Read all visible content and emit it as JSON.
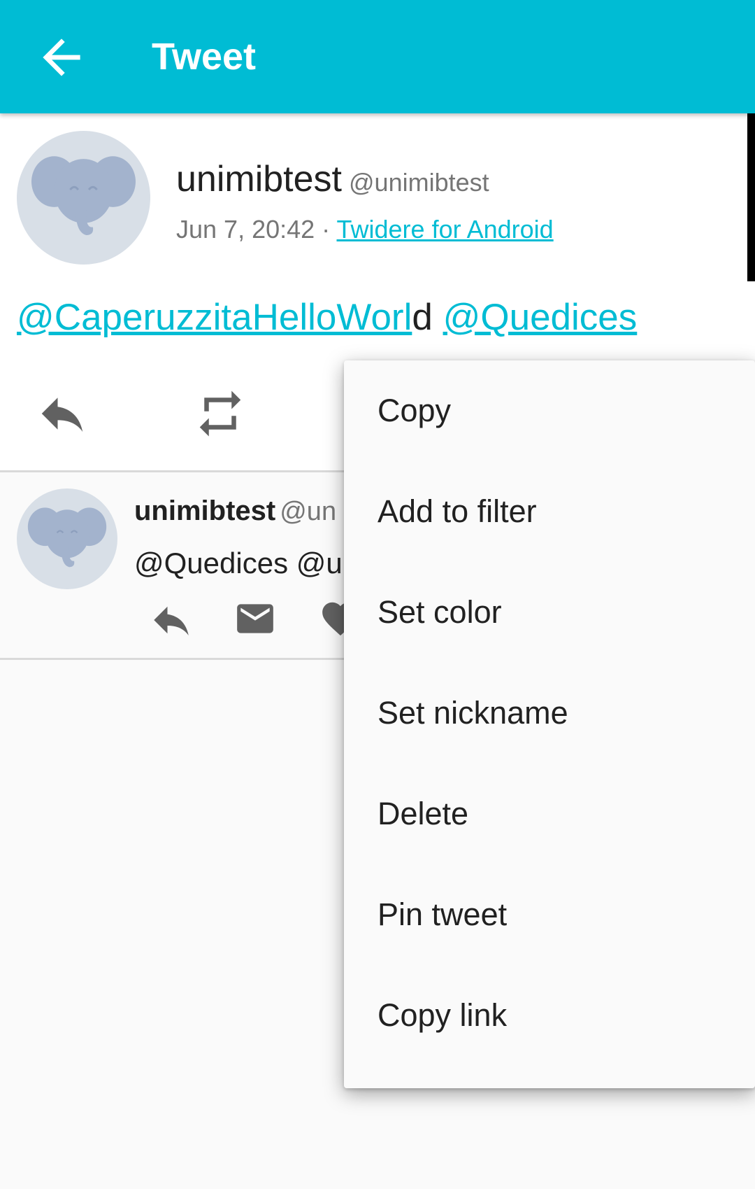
{
  "appbar": {
    "title": "Tweet",
    "back_icon": "arrow-back-icon"
  },
  "status": {
    "user_name": "unimibtest",
    "user_handle": "@unimibtest",
    "time": "Jun 7, 20:42",
    "separator": " · ",
    "source": "Twidere for Android",
    "text_parts": {
      "mention1": "@CaperuzzitaHelloWorl",
      "plain": "d ",
      "mention2": "@Quedices"
    }
  },
  "reply": {
    "user_name": "unimibtest",
    "user_handle_partial": "@un",
    "text_partial": "@Quedices @u"
  },
  "menu": {
    "items": [
      "Copy",
      "Add to filter",
      "Set color",
      "Set nickname",
      "Delete",
      "Pin tweet",
      "Copy link"
    ]
  },
  "colors": {
    "accent": "#00bcd4",
    "avatar_bg": "#d8dfe7",
    "elephant": "#a3b3cd"
  }
}
